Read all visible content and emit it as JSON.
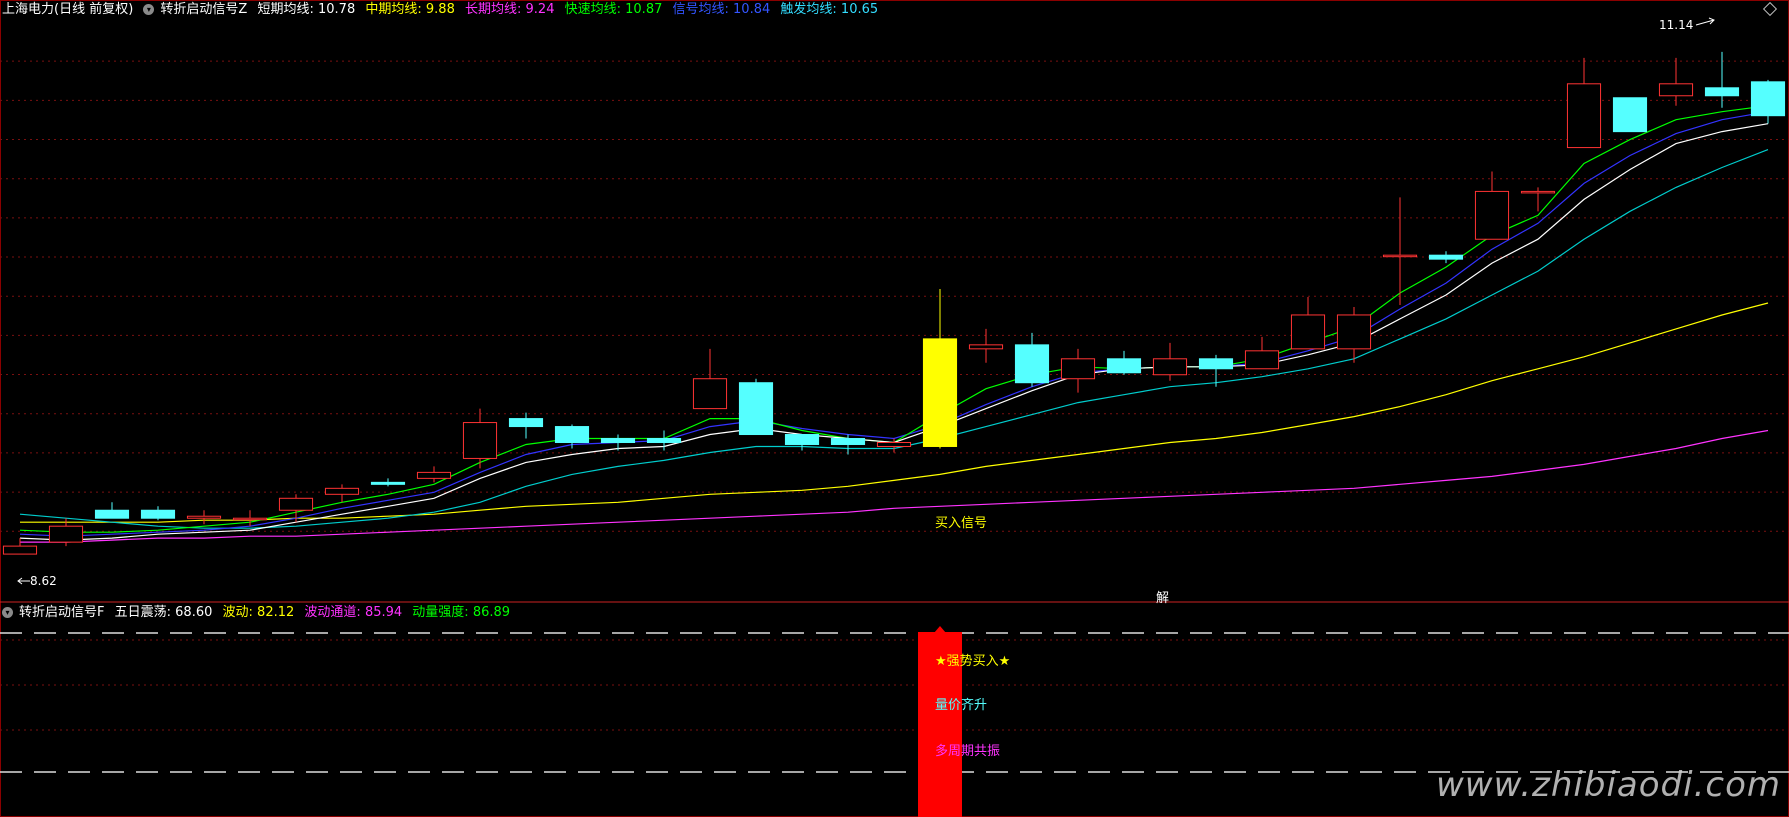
{
  "colors": {
    "background": "#000000",
    "grid": "#7a1010",
    "frame": "#8b0000",
    "up": "#ff3333",
    "down": "#55ffff",
    "signal_bar": "#ffff00",
    "short_ma": "#ffffff",
    "mid_ma": "#ffff00",
    "long_ma": "#ff33ff",
    "fast_ma": "#00ff00",
    "signal_ma": "#3333ff",
    "trigger_ma": "#00cccc",
    "buy_bar": "#ff0000"
  },
  "header": {
    "stock": "上海电力(日线 前复权)",
    "indicator": "转折启动信号Z",
    "short_label": "短期均线:",
    "short_value": "10.78",
    "mid_label": "中期均线:",
    "mid_value": "9.88",
    "long_label": "长期均线:",
    "long_value": "9.24",
    "fast_label": "快速均线:",
    "fast_value": "10.87",
    "signal_label": "信号均线:",
    "signal_value": "10.84",
    "trigger_label": "触发均线:",
    "trigger_value": "10.65"
  },
  "main_annotations": {
    "high_label": "11.14",
    "low_label": "8.62",
    "buy_signal": "买入信号",
    "jie": "解"
  },
  "sub_header": {
    "indicator": "转折启动信号F",
    "zd_label": "五日震荡:",
    "zd_value": "68.60",
    "bd_label": "波动:",
    "bd_value": "82.12",
    "td_label": "波动通道:",
    "td_value": "85.94",
    "dl_label": "动量强度:",
    "dl_value": "86.89"
  },
  "sub_annotations": {
    "strong_buy": "★强势买入★",
    "vol_price": "量价齐升",
    "multi_cycle": "多周期共振"
  },
  "watermark": "www.zhibiaodi.com",
  "chart_data": {
    "type": "candlestick",
    "price_range": [
      8.5,
      11.25
    ],
    "candles": [
      {
        "o": 8.62,
        "h": 8.7,
        "l": 8.62,
        "c": 8.66
      },
      {
        "o": 8.68,
        "h": 8.8,
        "l": 8.66,
        "c": 8.76
      },
      {
        "o": 8.84,
        "h": 8.88,
        "l": 8.8,
        "c": 8.8
      },
      {
        "o": 8.84,
        "h": 8.86,
        "l": 8.79,
        "c": 8.8
      },
      {
        "o": 8.8,
        "h": 8.84,
        "l": 8.77,
        "c": 8.81
      },
      {
        "o": 8.8,
        "h": 8.84,
        "l": 8.76,
        "c": 8.8
      },
      {
        "o": 8.84,
        "h": 8.92,
        "l": 8.78,
        "c": 8.9
      },
      {
        "o": 8.92,
        "h": 8.97,
        "l": 8.88,
        "c": 8.95
      },
      {
        "o": 8.98,
        "h": 9.0,
        "l": 8.96,
        "c": 8.97
      },
      {
        "o": 9.0,
        "h": 9.06,
        "l": 8.98,
        "c": 9.03
      },
      {
        "o": 9.1,
        "h": 9.35,
        "l": 9.05,
        "c": 9.28
      },
      {
        "o": 9.3,
        "h": 9.33,
        "l": 9.2,
        "c": 9.26
      },
      {
        "o": 9.26,
        "h": 9.27,
        "l": 9.15,
        "c": 9.18
      },
      {
        "o": 9.2,
        "h": 9.22,
        "l": 9.14,
        "c": 9.18
      },
      {
        "o": 9.2,
        "h": 9.24,
        "l": 9.14,
        "c": 9.18
      },
      {
        "o": 9.35,
        "h": 9.65,
        "l": 9.35,
        "c": 9.5
      },
      {
        "o": 9.48,
        "h": 9.5,
        "l": 9.22,
        "c": 9.22
      },
      {
        "o": 9.22,
        "h": 9.22,
        "l": 9.14,
        "c": 9.17
      },
      {
        "o": 9.2,
        "h": 9.22,
        "l": 9.12,
        "c": 9.17
      },
      {
        "o": 9.16,
        "h": 9.2,
        "l": 9.13,
        "c": 9.18
      },
      {
        "o": 9.16,
        "h": 9.95,
        "l": 9.15,
        "c": 9.7
      },
      {
        "o": 9.65,
        "h": 9.75,
        "l": 9.58,
        "c": 9.67
      },
      {
        "o": 9.67,
        "h": 9.73,
        "l": 9.46,
        "c": 9.48
      },
      {
        "o": 9.5,
        "h": 9.65,
        "l": 9.43,
        "c": 9.6
      },
      {
        "o": 9.6,
        "h": 9.64,
        "l": 9.52,
        "c": 9.53
      },
      {
        "o": 9.52,
        "h": 9.68,
        "l": 9.49,
        "c": 9.6
      },
      {
        "o": 9.6,
        "h": 9.62,
        "l": 9.46,
        "c": 9.55
      },
      {
        "o": 9.55,
        "h": 9.71,
        "l": 9.55,
        "c": 9.64
      },
      {
        "o": 9.65,
        "h": 9.91,
        "l": 9.65,
        "c": 9.82
      },
      {
        "o": 9.65,
        "h": 9.86,
        "l": 9.58,
        "c": 9.82
      },
      {
        "o": 10.12,
        "h": 10.41,
        "l": 9.87,
        "c": 10.12
      },
      {
        "o": 10.12,
        "h": 10.14,
        "l": 10.08,
        "c": 10.1
      },
      {
        "o": 10.2,
        "h": 10.54,
        "l": 10.2,
        "c": 10.44
      },
      {
        "o": 10.44,
        "h": 10.46,
        "l": 10.34,
        "c": 10.44
      },
      {
        "o": 10.66,
        "h": 11.11,
        "l": 10.66,
        "c": 10.98
      },
      {
        "o": 10.91,
        "h": 10.91,
        "l": 10.74,
        "c": 10.74
      },
      {
        "o": 10.92,
        "h": 11.11,
        "l": 10.87,
        "c": 10.98
      },
      {
        "o": 10.96,
        "h": 11.14,
        "l": 10.86,
        "c": 10.92
      },
      {
        "o": 10.99,
        "h": 11.0,
        "l": 10.78,
        "c": 10.82
      }
    ],
    "ma_short": [
      8.7,
      8.69,
      8.7,
      8.72,
      8.73,
      8.74,
      8.78,
      8.82,
      8.86,
      8.9,
      9.0,
      9.08,
      9.12,
      9.15,
      9.16,
      9.22,
      9.25,
      9.22,
      9.2,
      9.18,
      9.26,
      9.35,
      9.44,
      9.52,
      9.55,
      9.56,
      9.56,
      9.57,
      9.62,
      9.68,
      9.8,
      9.92,
      10.08,
      10.2,
      10.4,
      10.55,
      10.68,
      10.74,
      10.78
    ],
    "ma_mid": [
      8.78,
      8.78,
      8.78,
      8.78,
      8.79,
      8.79,
      8.8,
      8.8,
      8.81,
      8.82,
      8.84,
      8.86,
      8.87,
      8.88,
      8.9,
      8.92,
      8.93,
      8.94,
      8.96,
      8.99,
      9.02,
      9.06,
      9.09,
      9.12,
      9.15,
      9.18,
      9.2,
      9.23,
      9.27,
      9.31,
      9.36,
      9.42,
      9.49,
      9.55,
      9.61,
      9.68,
      9.75,
      9.82,
      9.88
    ],
    "ma_long": [
      8.68,
      8.68,
      8.69,
      8.7,
      8.7,
      8.71,
      8.71,
      8.72,
      8.73,
      8.74,
      8.75,
      8.76,
      8.77,
      8.78,
      8.79,
      8.8,
      8.81,
      8.82,
      8.83,
      8.85,
      8.86,
      8.87,
      8.88,
      8.89,
      8.9,
      8.91,
      8.92,
      8.93,
      8.94,
      8.95,
      8.97,
      8.99,
      9.01,
      9.04,
      9.07,
      9.11,
      9.15,
      9.2,
      9.24
    ],
    "ma_fast": [
      8.74,
      8.73,
      8.73,
      8.74,
      8.76,
      8.78,
      8.83,
      8.88,
      8.92,
      8.97,
      9.08,
      9.17,
      9.2,
      9.2,
      9.2,
      9.3,
      9.3,
      9.24,
      9.2,
      9.18,
      9.32,
      9.45,
      9.52,
      9.56,
      9.55,
      9.56,
      9.56,
      9.6,
      9.68,
      9.76,
      9.93,
      10.06,
      10.22,
      10.32,
      10.58,
      10.7,
      10.8,
      10.84,
      10.87
    ],
    "ma_signal": [
      8.72,
      8.71,
      8.72,
      8.73,
      8.74,
      8.76,
      8.8,
      8.85,
      8.89,
      8.93,
      9.03,
      9.12,
      9.17,
      9.18,
      9.19,
      9.26,
      9.29,
      9.25,
      9.22,
      9.2,
      9.27,
      9.37,
      9.46,
      9.53,
      9.55,
      9.56,
      9.56,
      9.58,
      9.64,
      9.71,
      9.85,
      9.98,
      10.15,
      10.28,
      10.48,
      10.62,
      10.73,
      10.8,
      10.84
    ],
    "ma_trigger": [
      8.82,
      8.8,
      8.78,
      8.76,
      8.75,
      8.75,
      8.76,
      8.78,
      8.8,
      8.83,
      8.88,
      8.96,
      9.02,
      9.06,
      9.09,
      9.13,
      9.16,
      9.16,
      9.15,
      9.15,
      9.2,
      9.26,
      9.32,
      9.38,
      9.42,
      9.46,
      9.48,
      9.51,
      9.55,
      9.6,
      9.7,
      9.8,
      9.92,
      10.04,
      10.2,
      10.34,
      10.46,
      10.56,
      10.65
    ],
    "buy_signal_index": 20,
    "sub_series": {
      "five_day_oscillation": 68.6,
      "volatility": 82.12,
      "volatility_channel": 85.94,
      "momentum_strength": 86.89
    }
  }
}
